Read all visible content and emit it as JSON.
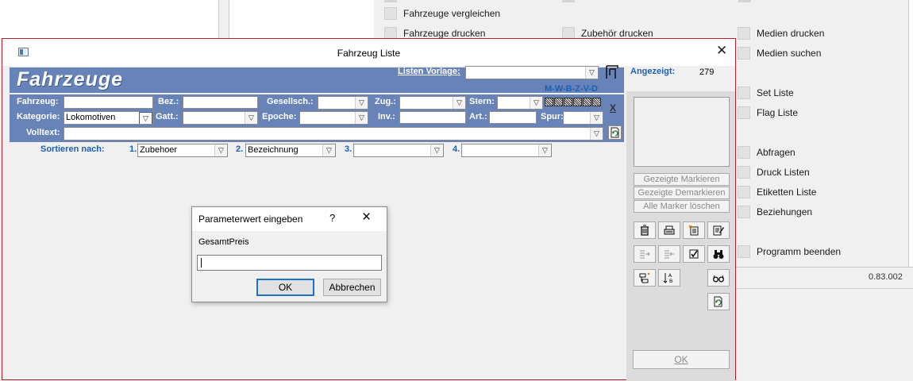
{
  "background_app": {
    "buttons": [
      "Fahrzeuge vergleichen",
      "Fahrzeuge drucken",
      "Zubehör drucken",
      "Medien drucken",
      "Medien suchen",
      "Set Liste",
      "Flag Liste",
      "Abfragen",
      "Druck Listen",
      "Etiketten Liste",
      "Beziehungen",
      "Programm beenden"
    ],
    "version": "0.83.002"
  },
  "window": {
    "title": "Fahrzeug Liste",
    "header": "Fahrzeuge",
    "listen_vorlage_label": "Listen Vorlage:",
    "listen_vorlage_value": "",
    "angezeigt_label": "Angezeigt:",
    "angezeigt_value": "279",
    "marker_letters": "M-W-B-Z-V-D",
    "filter": {
      "fahrzeug_label": "Fahrzeug:",
      "fahrzeug_value": "",
      "bez_label": "Bez.:",
      "bez_value": "",
      "gesellsch_label": "Gesellsch.:",
      "gesellsch_value": "",
      "zug_label": "Zug.:",
      "zug_value": "",
      "stern_label": "Stern:",
      "stern_value": "",
      "kategorie_label": "Kategorie:",
      "kategorie_value": "Lokomotiven",
      "gatt_label": "Gatt.:",
      "gatt_value": "",
      "epoche_label": "Epoche:",
      "epoche_value": "",
      "inv_label": "Inv.:",
      "inv_value": "",
      "art_label": "Art.:",
      "art_value": "",
      "spur_label": "Spur:",
      "spur_value": "",
      "volltext_label": "Volltext:",
      "volltext_value": "",
      "clear_label": "X"
    },
    "sort": {
      "label": "Sortieren nach:",
      "n1": "1.",
      "v1": "Zubehoer",
      "n2": "2.",
      "v2": "Bezeichnung",
      "n3": "3.",
      "v3": "",
      "n4": "4.",
      "v4": ""
    },
    "side_buttons": {
      "markieren": "Gezeigte Markieren",
      "demarkieren": "Gezeigte Demarkieren",
      "marker_loeschen": "Alle Marker löschen",
      "ok": "OK"
    }
  },
  "dialog": {
    "title": "Parameterwert eingeben",
    "help": "?",
    "close": "×",
    "prompt": "GesamtPreis",
    "input_value": "",
    "ok": "OK",
    "cancel": "Abbrechen"
  },
  "colors": {
    "window_border": "#b4202a",
    "blue_bar": "#6783b8",
    "label_blue": "#1d5fb5"
  }
}
